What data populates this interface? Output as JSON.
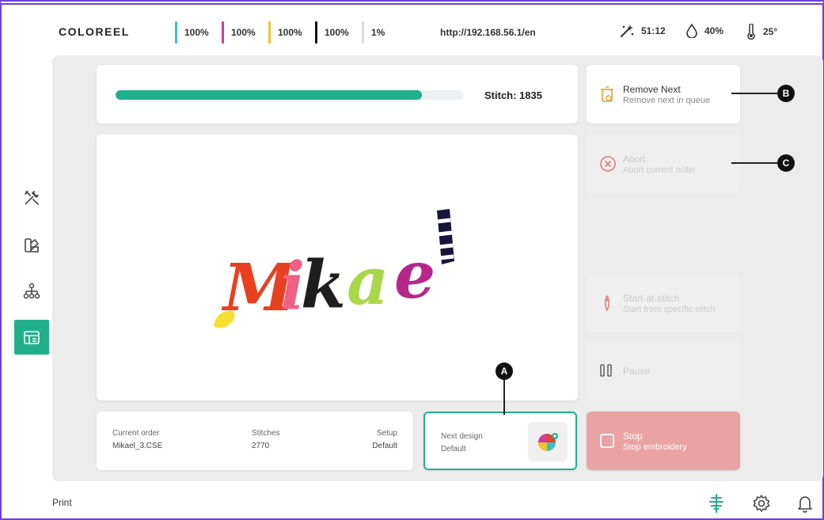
{
  "header": {
    "brand": "COLOREEL",
    "inks": [
      {
        "value": "100%",
        "color": "#36c1cf"
      },
      {
        "value": "100%",
        "color": "#d33b9c"
      },
      {
        "value": "100%",
        "color": "#f2c230"
      },
      {
        "value": "100%",
        "color": "#111111"
      },
      {
        "value": "1%",
        "color": "#dddddd"
      }
    ],
    "url": "http://192.168.56.1/en",
    "time": "51:12",
    "humidity": "40%",
    "temperature": "25°"
  },
  "progress": {
    "fraction": 0.88,
    "stitch_label": "Stitch: 1835"
  },
  "preview": {
    "design_text": "Mikael"
  },
  "order": {
    "current_order_label": "Current order",
    "current_order_value": "Mikael_3.CSE",
    "stitches_label": "Stitches",
    "stitches_value": "2770",
    "setup_label": "Setup",
    "setup_value": "Default"
  },
  "next_design": {
    "label": "Next design",
    "value": "Default"
  },
  "actions": {
    "remove_next": {
      "title": "Remove Next",
      "subtitle": "Remove next in queue"
    },
    "abort": {
      "title": "Abort",
      "subtitle": "Abort current order"
    },
    "start_at_stitch": {
      "title": "Start-at-stitch",
      "subtitle": "Start from specific stitch"
    },
    "pause": {
      "title": "Pause"
    },
    "stop": {
      "title": "Stop",
      "subtitle": "Stop embroidery"
    }
  },
  "callouts": {
    "a": "A",
    "b": "B",
    "c": "C"
  },
  "footer": {
    "print_label": "Print"
  },
  "icons": {
    "sidebar": [
      "tools-icon",
      "color-palette-icon",
      "network-icon",
      "embroidery-machine-icon"
    ],
    "footer": [
      "machine-status-icon",
      "gear-icon",
      "bell-icon"
    ]
  },
  "colors": {
    "accent": "#1fb08a",
    "stop": "#e9a3a3",
    "remove_icon": "#e9a23b",
    "abort_icon": "#e07878"
  }
}
